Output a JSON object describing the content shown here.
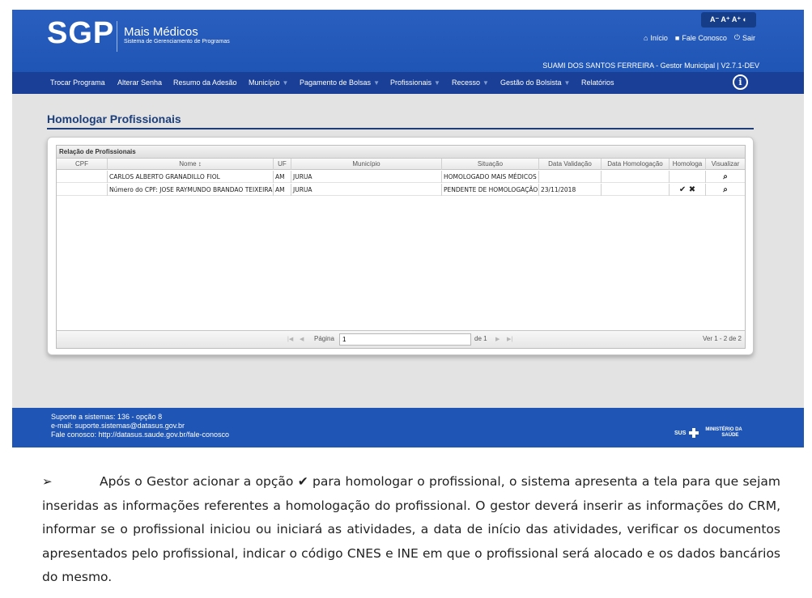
{
  "header": {
    "logo": "SGP",
    "brand_title": "Mais Médicos",
    "brand_subtitle": "Sistema de Gerenciamento de Programas",
    "accessibility": "A⁻ A⁺ A⁺ ◐",
    "links": [
      {
        "label": "Início",
        "icon": "home-icon"
      },
      {
        "label": "Fale Conosco",
        "icon": "chat-icon"
      },
      {
        "label": "Sair",
        "icon": "power-icon"
      }
    ],
    "user_line": "SUAMI DOS SANTOS FERREIRA - Gestor Municipal | V2.7.1-DEV"
  },
  "nav": {
    "items": [
      {
        "label": "Trocar Programa",
        "dropdown": false
      },
      {
        "label": "Alterar Senha",
        "dropdown": false
      },
      {
        "label": "Resumo da Adesão",
        "dropdown": false
      },
      {
        "label": "Município",
        "dropdown": true
      },
      {
        "label": "Pagamento de Bolsas",
        "dropdown": true
      },
      {
        "label": "Profissionais",
        "dropdown": true
      },
      {
        "label": "Recesso",
        "dropdown": true
      },
      {
        "label": "Gestão do Bolsista",
        "dropdown": true
      },
      {
        "label": "Relatórios",
        "dropdown": false
      }
    ]
  },
  "page": {
    "title": "Homologar Profissionais",
    "grid_caption": "Relação de Profissionais",
    "columns": [
      "CPF",
      "Nome ↕",
      "UF",
      "Município",
      "Situação",
      "Data Validação",
      "Data Homologação",
      "Homologa",
      "Visualizar"
    ],
    "rows": [
      {
        "cpf": "",
        "nome": "CARLOS ALBERTO GRANADILLO FIOL",
        "uf": "AM",
        "municipio": "JURUA",
        "situacao": "HOMOLOGADO MAIS MÉDICOS",
        "data_validacao": "",
        "data_homologacao": "",
        "homologa": "",
        "visualizar": "⌕"
      },
      {
        "cpf": "",
        "nome": "Número do CPF: JOSE RAYMUNDO BRANDAO TEIXEIRA",
        "uf": "AM",
        "municipio": "JURUA",
        "situacao": "PENDENTE DE HOMOLOGAÇÃO",
        "data_validacao": "23/11/2018",
        "data_homologacao": "",
        "homologa": "✔ ✖",
        "visualizar": "⌕"
      }
    ],
    "pager": {
      "page_label": "Página",
      "page_value": "1",
      "of_label": "de 1",
      "range": "Ver 1 - 2 de 2"
    }
  },
  "footer": {
    "lines": [
      "Suporte a sistemas: 136 - opção 8",
      "e-mail: suporte.sistemas@datasus.gov.br",
      "Fale conosco: http://datasus.saude.gov.br/fale-conosco"
    ],
    "sus": "SUS",
    "ministry_line1": "MINISTÉRIO DA",
    "ministry_line2": "SAÚDE"
  },
  "doc": {
    "bullet": "➢",
    "paragraph_before_icon": "Após o Gestor acionar a opção",
    "icon": "✔",
    "paragraph_after_icon": "para homologar o profissional, o sistema apresenta a tela para que sejam inseridas as informações referentes a homologação do profissional. O gestor deverá inserir as informações do CRM, informar se o profissional iniciou ou iniciará as atividades, a data de início das atividades, verificar os documentos apresentados pelo profissional, indicar o código CNES e INE em que o profissional será alocado e os dados bancários do mesmo."
  }
}
